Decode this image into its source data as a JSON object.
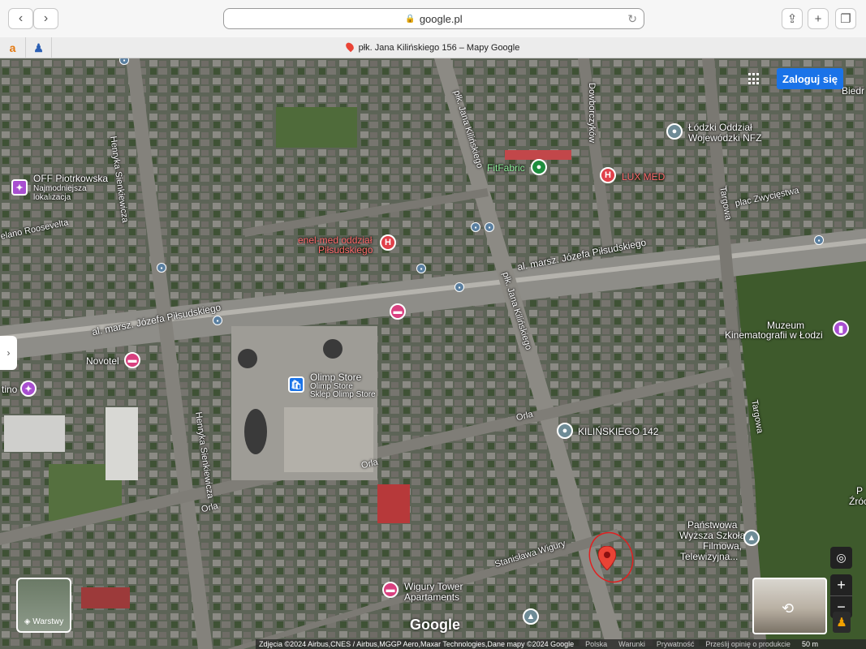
{
  "browser": {
    "back": "‹",
    "forward": "›",
    "url": "google.pl",
    "tab_title": "płk. Jana Kilińskiego 156 – Mapy Google",
    "favorite_1": "a",
    "favorite_2": "♟"
  },
  "map": {
    "streets": {
      "henryka_1": "Henryka Sienkiewicza",
      "henryka_2": "Henryka Sienkiewicza",
      "kilinskiego_1": "płk. Jana Kilińskiego",
      "kilinskiego_2": "płk. Jana Kilińskiego",
      "dowborczykow": "Dowborczyków",
      "targowa_1": "Targowa",
      "targowa_2": "Targowa",
      "plac": "plac Zwycięstwa",
      "pilsudskiego_1": "al. marsz. Józefa Piłsudskiego",
      "pilsudskiego_2": "al. marsz. Józefa Piłsudskiego",
      "roosevelta": "elano Roosevelta",
      "orla_1": "Orla",
      "orla_2": "Orla",
      "orla_3": "Orla",
      "wigury": "Stanisława Wigury"
    },
    "places": {
      "off_title": "OFF Piotrkowska",
      "off_sub1": "Najmodniejsza",
      "off_sub2": "lokalizacja",
      "fitfabric": "FitFabric",
      "luxmed": "LUX MED",
      "nfz_1": "Łódzki Oddział",
      "nfz_2": "Wojewódzki NFZ",
      "enel_1": "enel-med oddział",
      "enel_2": "Piłsudskiego",
      "novotel": "Novotel",
      "tino": "tino",
      "olimp_title": "Olimp Store",
      "olimp_sub1": "Olimp Store",
      "olimp_sub2": "Sklep Olimp Store",
      "muzeum_1": "Muzeum",
      "muzeum_2": "Kinematografii w Łodzi",
      "kilinskiego142": "KILIŃSKIEGO 142",
      "pwsf_1": "Państwowa",
      "pwsf_2": "Wyższa Szkoła",
      "pwsf_3": "Filmowa,",
      "pwsf_4": "Telewizyjna...",
      "wigury_1": "Wigury Tower",
      "wigury_2": "Apartaments",
      "biedr": "Biedr",
      "zrodl_1": "P",
      "zrodl_2": "Źróc"
    },
    "login": "Zaloguj się",
    "layers": "Warstwy",
    "google": "Google",
    "footer": {
      "credits": "Zdjęcia ©2024 Airbus,CNES / Airbus,MGGP Aero,Maxar Technologies,Dane mapy ©2024 Google",
      "polska": "Polska",
      "warunki": "Warunki",
      "prywatnosc": "Prywatność",
      "opinia": "Prześlij opinię o produkcie",
      "scale": "50 m"
    }
  }
}
